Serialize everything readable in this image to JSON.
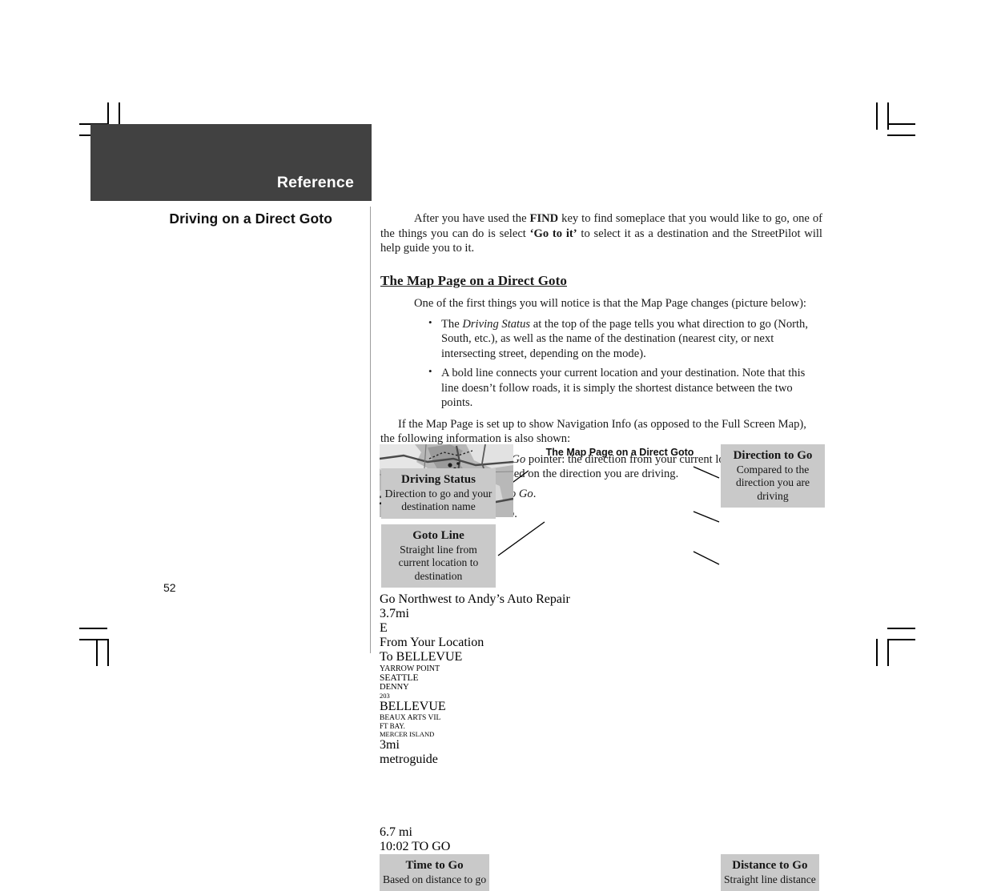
{
  "header": {
    "band_title": "Reference",
    "band_color": "#414141"
  },
  "left_column": {
    "section_title": "Driving on a Direct Goto",
    "page_number": "52"
  },
  "body": {
    "intro": "After you have used the FIND key to find someplace that you would like to go, one of the things you can do is select ‘Go to it’ to select it as a destination and the StreetPilot will help guide you to it.",
    "intro_bold_1": "FIND",
    "intro_bold_2": "‘Go to it’",
    "intro_part_a": "After you have used the ",
    "intro_part_b": " key to find someplace that you would like to go, one of the things you can do is select ",
    "intro_part_c": " to select it as a destination and the StreetPilot will help guide you to it.",
    "subhead": "The Map Page on a Direct Goto",
    "lead": "One of the first things you will notice is that the Map Page changes (picture below):",
    "bullets_1": [
      {
        "pre": "The ",
        "italic": "Driving Status",
        "post": " at the top of the page tells you what direction to go (North, South, etc.), as well as the name of the destination (nearest city, or next intersecting street, depending on the mode)."
      },
      {
        "pre": "A bold line connects your current location and your destination.  Note that this line doesn’t follow roads, it is simply the shortest distance between the two points.",
        "italic": "",
        "post": ""
      }
    ],
    "mid_para": "If the Map Page is set up to show Navigation Info (as opposed to the Full Screen Map), the following information is also shown:",
    "bullets_2": [
      {
        "pre": "A ",
        "italic": "Direction to Go",
        "post": " pointer: the direction from your current location to the destination, based on the direction you are driving."
      },
      {
        "pre": "The ",
        "italic": "Distance to Go",
        "post": "."
      },
      {
        "pre": "The ",
        "italic": "Time to Go",
        "post": "."
      }
    ]
  },
  "figure": {
    "caption": "The Map Page on a Direct Goto",
    "callouts": [
      {
        "id": "driving-status",
        "title": "Driving Status",
        "desc": "Direction to go and your destination name"
      },
      {
        "id": "goto-line",
        "title": "Goto Line",
        "desc": "Straight line from current location to destination"
      },
      {
        "id": "direction-to-go",
        "title": "Direction to Go",
        "desc": "Compared to the direction you are driving"
      },
      {
        "id": "distance-to-go",
        "title": "Distance to Go",
        "desc": "Straight line distance"
      },
      {
        "id": "time-to-go",
        "title": "Time to Go",
        "desc": "Based on distance to go"
      }
    ],
    "callout_bg": "#c9c9c9"
  },
  "gps_screen": {
    "title_bar": "Go Northwest to Andy’s Auto Repair",
    "info_distance": "3.7",
    "info_distance_unit": "mi",
    "info_direction": "E",
    "info_line1": "From Your Location",
    "info_line2": "To BELLEVUE",
    "distance_value": "6.7",
    "distance_unit": "mi",
    "time_value": "10:02",
    "time_unit": "TO GO",
    "map_labels": [
      "YARROW POINT",
      "SEATTLE",
      "DENNY",
      "203",
      "BELLEVUE",
      "BEAUX ARTS VIL",
      "FT BAY.",
      "MERCER ISLAND"
    ],
    "map_scale": "3",
    "map_scale_unit": "mi",
    "map_source": "metroguide"
  }
}
